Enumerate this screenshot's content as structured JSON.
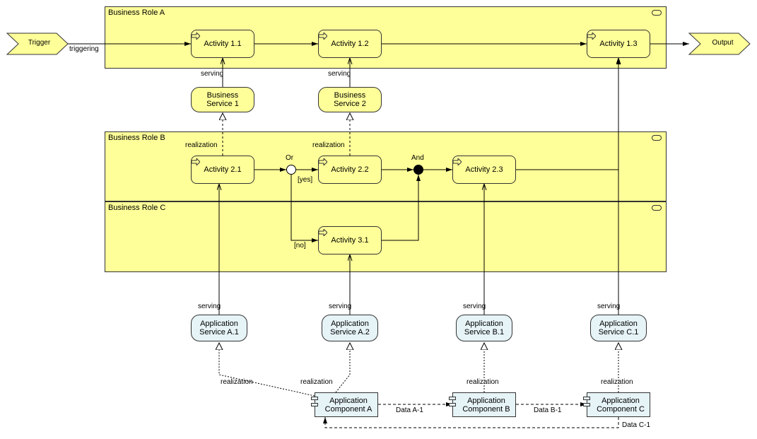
{
  "event_trigger": "Trigger",
  "event_output": "Output",
  "lanes": {
    "a": "Business Role A",
    "b": "Business Role B",
    "c": "Business Role C"
  },
  "activities": {
    "a11": "Activity 1.1",
    "a12": "Activity 1.2",
    "a13": "Activity 1.3",
    "a21": "Activity 2.1",
    "a22": "Activity 2.2",
    "a23": "Activity 2.3",
    "a31": "Activity 3.1"
  },
  "biz_services": {
    "bs1": "Business Service 1",
    "bs2": "Business Service 2"
  },
  "app_services": {
    "asA1": "Application Service A.1",
    "asA2": "Application Service A.2",
    "asB1": "Application Service B.1",
    "asC1": "Application Service C.1"
  },
  "app_components": {
    "acA": "Application Component A",
    "acB": "Application Component B",
    "acC": "Application Component C"
  },
  "junctions": {
    "or": "Or",
    "and": "And"
  },
  "guards": {
    "yes": "[yes]",
    "no": "[no]"
  },
  "rel": {
    "triggering": "triggering",
    "serving": "serving",
    "realization": "realization"
  },
  "data": {
    "a1": "Data A-1",
    "b1": "Data B-1",
    "c1": "Data C-1"
  }
}
